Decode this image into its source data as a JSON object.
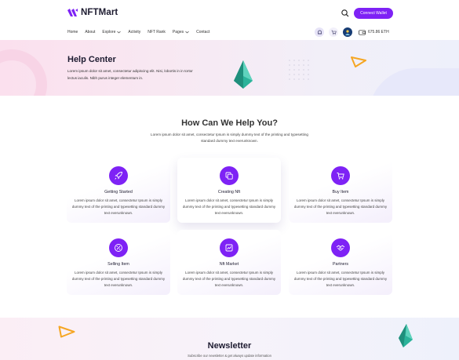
{
  "brand": {
    "name": "NFTMart",
    "accent": "#7e22f5"
  },
  "header": {
    "connect_label": "Connect Wallet",
    "nav": [
      {
        "label": "Home"
      },
      {
        "label": "About"
      },
      {
        "label": "Explore"
      },
      {
        "label": "Activity"
      },
      {
        "label": "NFT Rank"
      },
      {
        "label": "Pages"
      },
      {
        "label": "Contact"
      }
    ],
    "balance": "675.86 ETH"
  },
  "hero": {
    "title": "Help Center",
    "description": "Lorem ipsum dolor sit amet, consectetur adipiscing elit. Nisi, lobortis in in tortor lectus iaculis. Nibh purus integer elementum in."
  },
  "help": {
    "title": "How Can We Help You?",
    "description": "Lorem ipsum dolor sit amet, consectetur Ipsum is simply dummy text of the printing and typesetting standard dummy text everunknown.",
    "cards": [
      {
        "title": "Getting Started",
        "icon": "rocket-icon",
        "text": "Lorem ipsum dolor sit amet, consectetur Ipsum is simply dummy text of the printing and typesetting standard dummy text everunknown."
      },
      {
        "title": "Creating Nft",
        "icon": "copy-icon",
        "text": "Lorem ipsum dolor sit amet, consectetur Ipsum is simply dummy text of the printing and typesetting standard dummy text everunknown."
      },
      {
        "title": "Buy Item",
        "icon": "cart-icon",
        "text": "Lorem ipsum dolor sit amet, consectetur Ipsum is simply dummy text of the printing and typesetting standard dummy text everunknown."
      },
      {
        "title": "Selling Item",
        "icon": "percent-icon",
        "text": "Lorem ipsum dolor sit amet, consectetur Ipsum is simply dummy text of the printing and typesetting standard dummy text everunknown."
      },
      {
        "title": "Nft Market",
        "icon": "chart-icon",
        "text": "Lorem ipsum dolor sit amet, consectetur Ipsum is simply dummy text of the printing and typesetting standard dummy text everunknown."
      },
      {
        "title": "Partners",
        "icon": "handshake-icon",
        "text": "Lorem ipsum dolor sit amet, consectetur Ipsum is simply dummy text of the printing and typesetting standard dummy text everunknown."
      }
    ]
  },
  "newsletter": {
    "title": "Newsletter",
    "subtitle": "Subscribe our newsletter & get always update information"
  }
}
